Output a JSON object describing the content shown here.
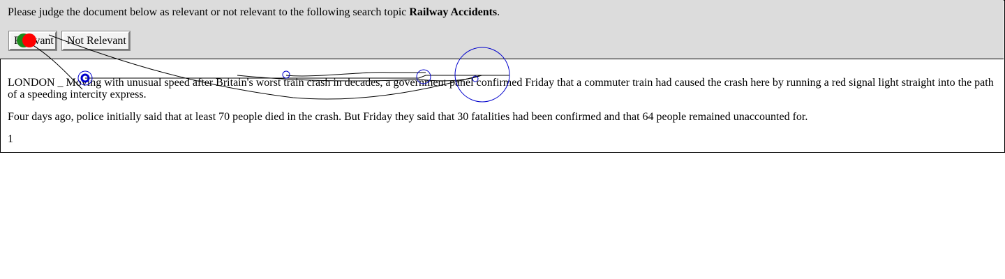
{
  "prompt": {
    "text": "Please judge the document below as relevant or not relevant to the following search topic ",
    "topic": "Railway Accidents",
    "end": "."
  },
  "buttons": {
    "relevant": "Relevant",
    "not_relevant": "Not Relevant"
  },
  "document": {
    "paragraphs": [
      "LONDON _ Moving with unusual speed after Britain's worst train crash in decades, a government panel confirmed Friday that a commuter train had caused the crash here by running a red signal light straight into the path of a speeding intercity express.",
      "Four days ago, police initially said that at least 70 people died in the crash. But Friday they said that 30 fatalities had been confirmed and that 64 people remained unaccounted for."
    ],
    "page_number": "1"
  },
  "colors": {
    "header_bg": "#dcdcdc",
    "gaze_circle": "#0000cc",
    "gaze_path": "#000000",
    "click_marker_green": "#1a8a1a",
    "click_marker_red": "#ff0000"
  }
}
